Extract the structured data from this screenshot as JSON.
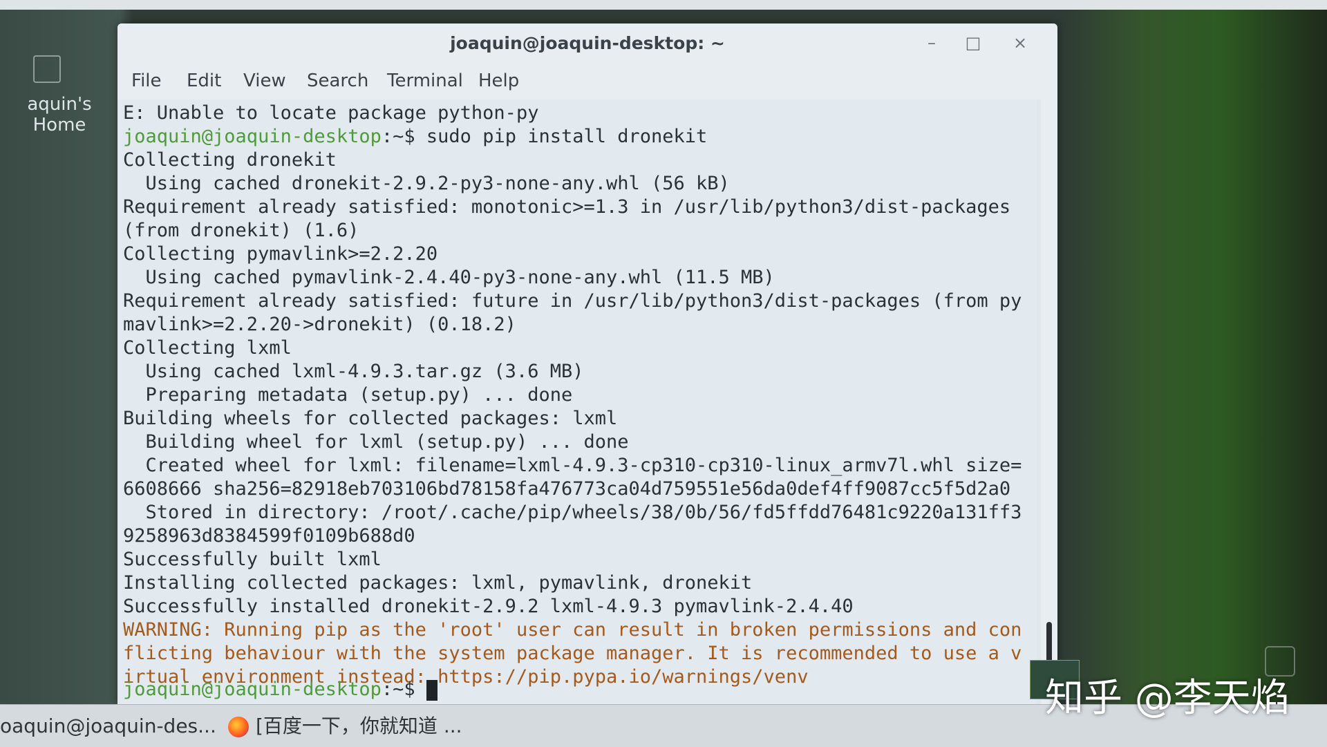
{
  "desktop": {
    "home_icon_label": "aquin's Home"
  },
  "window": {
    "title": "joaquin@joaquin-desktop: ~",
    "buttons": {
      "minimize": "–",
      "maximize": "□",
      "close": "×"
    }
  },
  "menu": [
    "File",
    "Edit",
    "View",
    "Search",
    "Terminal",
    "Help"
  ],
  "terminal": {
    "lines": [
      "E: Unable to locate package python-py",
      "Collecting dronekit",
      "  Using cached dronekit-2.9.2-py3-none-any.whl (56 kB)",
      "Requirement already satisfied: monotonic>=1.3 in /usr/lib/python3/dist-packages",
      "(from dronekit) (1.6)",
      "Collecting pymavlink>=2.2.20",
      "  Using cached pymavlink-2.4.40-py3-none-any.whl (11.5 MB)",
      "Requirement already satisfied: future in /usr/lib/python3/dist-packages (from py",
      "mavlink>=2.2.20->dronekit) (0.18.2)",
      "Collecting lxml",
      "  Using cached lxml-4.9.3.tar.gz (3.6 MB)",
      "  Preparing metadata (setup.py) ... done",
      "Building wheels for collected packages: lxml",
      "  Building wheel for lxml (setup.py) ... done",
      "  Created wheel for lxml: filename=lxml-4.9.3-cp310-cp310-linux_armv7l.whl size=",
      "6608666 sha256=82918eb703106bd78158fa476773ca04d759551e56da0def4ff9087cc5f5d2a0",
      "  Stored in directory: /root/.cache/pip/wheels/38/0b/56/fd5ffdd76481c9220a131ff3",
      "9258963d8384599f0109b688d0",
      "Successfully built lxml",
      "Installing collected packages: lxml, pymavlink, dronekit",
      "Successfully installed dronekit-2.9.2 lxml-4.9.3 pymavlink-2.4.40"
    ],
    "prompt_user": "joaquin@joaquin-desktop",
    "prompt_path": ":~$",
    "command": " sudo pip install dronekit",
    "warning_lines": [
      "WARNING: Running pip as the 'root' user can result in broken permissions and con",
      "flicting behaviour with the system package manager. It is recommended to use a v",
      "irtual environment instead: https://pip.pypa.io/warnings/venv"
    ]
  },
  "taskbar": {
    "items": [
      "oaquin@joaquin-des...",
      "[百度一下，你就知道 ..."
    ]
  },
  "watermark": "知乎 @李天焰"
}
